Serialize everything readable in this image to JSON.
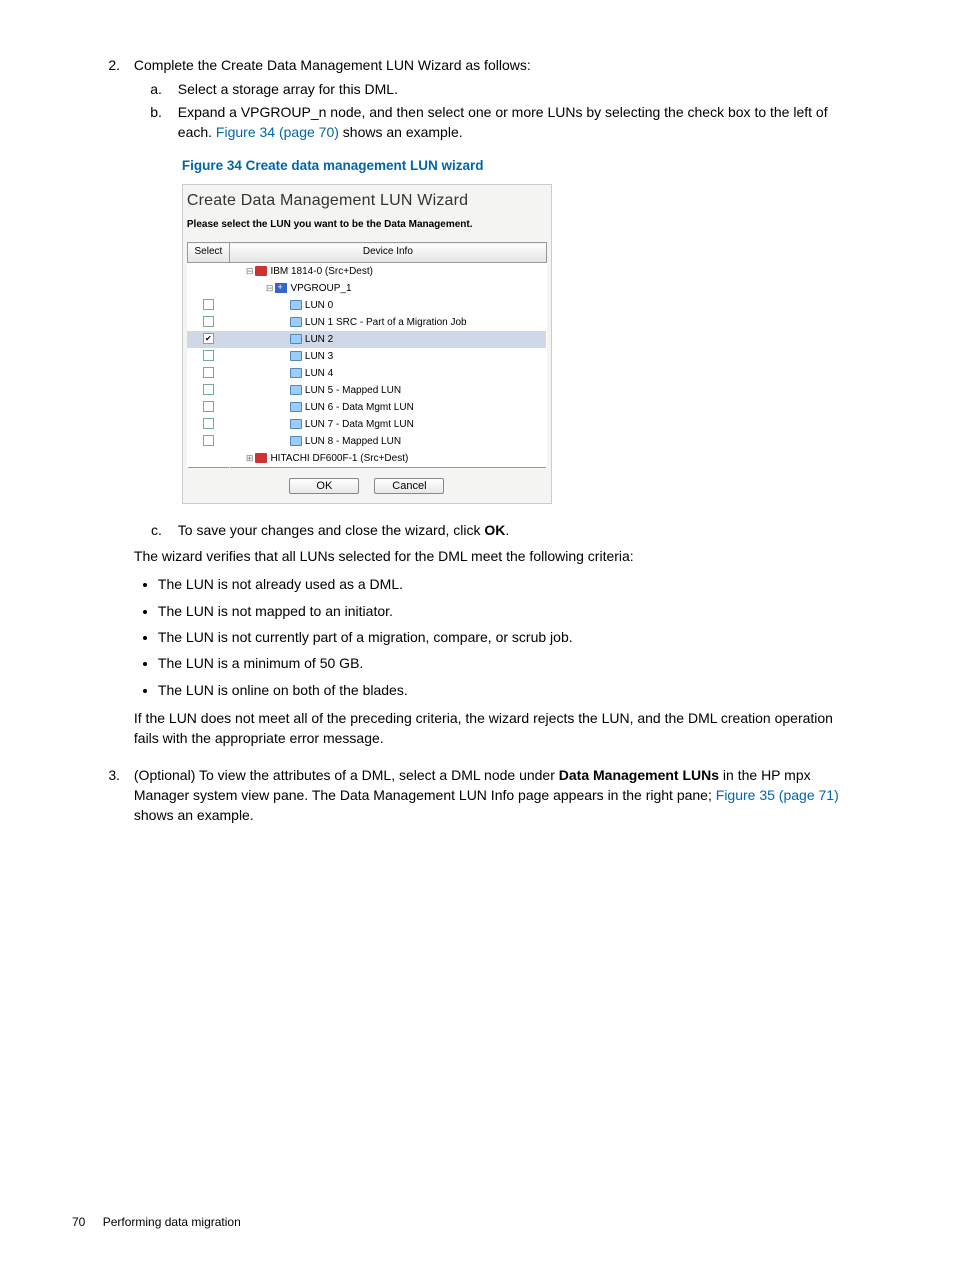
{
  "steps": {
    "s2": {
      "num": "2.",
      "text_a": "Complete the Create Data Management LUN Wizard as follows:",
      "a": {
        "num": "a.",
        "text": "Select a storage array for this DML."
      },
      "b": {
        "num": "b.",
        "text_before": "Expand a VPGROUP_n node, and then select one or more LUNs by selecting the check box to the left of each. ",
        "link": "Figure 34 (page 70)",
        "text_after": " shows an example."
      },
      "c": {
        "num": "c.",
        "text_before": "To save your changes and close the wizard, click ",
        "bold": "OK",
        "text_after": "."
      },
      "verify_intro": "The wizard verifies that all LUNs selected for the DML meet the following criteria:",
      "bullets": [
        "The LUN is not already used as a DML.",
        "The LUN is not mapped to an initiator.",
        "The LUN is not currently part of a migration, compare, or scrub job.",
        "The LUN is a minimum of 50 GB.",
        "The LUN is online on both of the blades."
      ],
      "fail_text": "If the LUN does not meet all of the preceding criteria, the wizard rejects the LUN, and the DML creation operation fails with the appropriate error message."
    },
    "s3": {
      "num": "3.",
      "text_before": "(Optional) To view the attributes of a DML, select a DML node under ",
      "bold": "Data Management LUNs",
      "text_mid": " in the HP mpx Manager system view pane. The Data Management LUN Info page appears in the right pane; ",
      "link": "Figure 35 (page 71)",
      "text_after": " shows an example."
    }
  },
  "figure": {
    "caption": "Figure 34 Create data management LUN wizard",
    "title": "Create Data Management LUN Wizard",
    "instruction": "Please select the LUN you want to be the Data Management.",
    "col_select": "Select",
    "col_device": "Device Info",
    "rows": [
      {
        "indent": 1,
        "type": "array",
        "expand": "⊟",
        "label": "IBM 1814-0 (Src+Dest)",
        "checkbox": null,
        "selected": false
      },
      {
        "indent": 2,
        "type": "group",
        "expand": "⊟",
        "label": "VPGROUP_1",
        "checkbox": null,
        "selected": false
      },
      {
        "indent": 3,
        "type": "lun",
        "label": "LUN 0",
        "checkbox": false,
        "selected": false
      },
      {
        "indent": 3,
        "type": "lun",
        "label": "LUN 1 SRC - Part of a Migration Job",
        "checkbox": false,
        "selected": false
      },
      {
        "indent": 3,
        "type": "lun",
        "label": "LUN 2",
        "checkbox": true,
        "selected": true
      },
      {
        "indent": 3,
        "type": "lun",
        "label": "LUN 3",
        "checkbox": false,
        "selected": false
      },
      {
        "indent": 3,
        "type": "lun",
        "label": "LUN 4",
        "checkbox": false,
        "selected": false
      },
      {
        "indent": 3,
        "type": "lun",
        "label": "LUN 5 - Mapped LUN",
        "checkbox": false,
        "selected": false
      },
      {
        "indent": 3,
        "type": "lun",
        "label": "LUN 6 - Data Mgmt LUN",
        "checkbox": false,
        "selected": false
      },
      {
        "indent": 3,
        "type": "lun",
        "label": "LUN 7 - Data Mgmt LUN",
        "checkbox": false,
        "selected": false
      },
      {
        "indent": 3,
        "type": "lun",
        "label": "LUN 8 - Mapped LUN",
        "checkbox": false,
        "selected": false
      },
      {
        "indent": 1,
        "type": "array",
        "expand": "⊞",
        "label": "HITACHI DF600F-1 (Src+Dest)",
        "checkbox": null,
        "selected": false
      }
    ],
    "btn_ok": "OK",
    "btn_cancel": "Cancel"
  },
  "footer": {
    "page": "70",
    "section": "Performing data migration"
  }
}
